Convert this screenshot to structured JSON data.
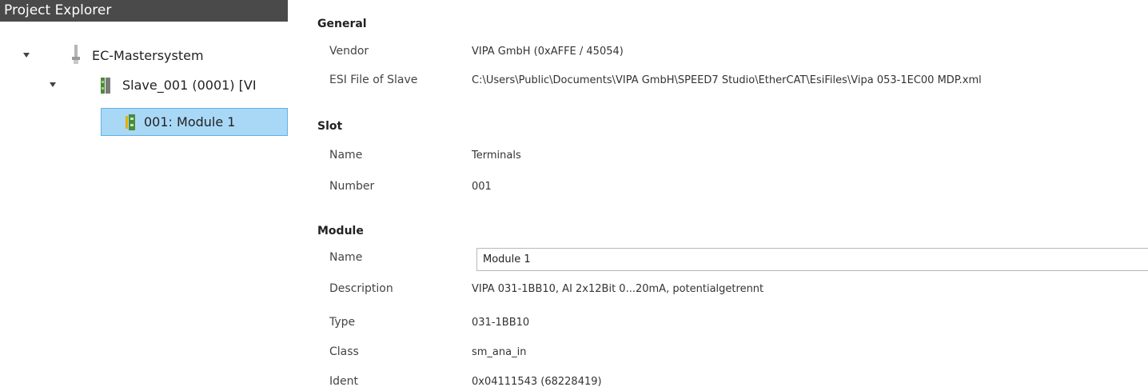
{
  "explorer": {
    "title": "Project Explorer",
    "tree": [
      {
        "label": "EC-Mastersystem",
        "icon": "ethercat-master-icon",
        "expanded": true
      },
      {
        "label": "Slave_001 (0001) [VI",
        "icon": "slave-device-icon",
        "expanded": true
      },
      {
        "label": "001: Module 1",
        "icon": "module-icon",
        "selected": true
      }
    ]
  },
  "properties": {
    "general": {
      "title": "General",
      "vendor_label": "Vendor",
      "vendor_value": "VIPA GmbH (0xAFFE / 45054)",
      "esi_label": "ESI File of Slave",
      "esi_value": "C:\\Users\\Public\\Documents\\VIPA GmbH\\SPEED7 Studio\\EtherCAT\\EsiFiles\\Vipa 053-1EC00 MDP.xml"
    },
    "slot": {
      "title": "Slot",
      "name_label": "Name",
      "name_value": "Terminals",
      "number_label": "Number",
      "number_value": "001"
    },
    "module": {
      "title": "Module",
      "name_label": "Name",
      "name_value": "Module 1",
      "description_label": "Description",
      "description_value": "VIPA 031-1BB10, AI 2x12Bit 0...20mA, potentialgetrennt",
      "type_label": "Type",
      "type_value": "031-1BB10",
      "class_label": "Class",
      "class_value": "sm_ana_in",
      "ident_label": "Ident",
      "ident_value": "0x04111543 (68228419)"
    }
  },
  "colors": {
    "header_bg": "#4a4a4a",
    "selection_bg": "#a9d8f7",
    "selection_border": "#5fb0e8"
  }
}
